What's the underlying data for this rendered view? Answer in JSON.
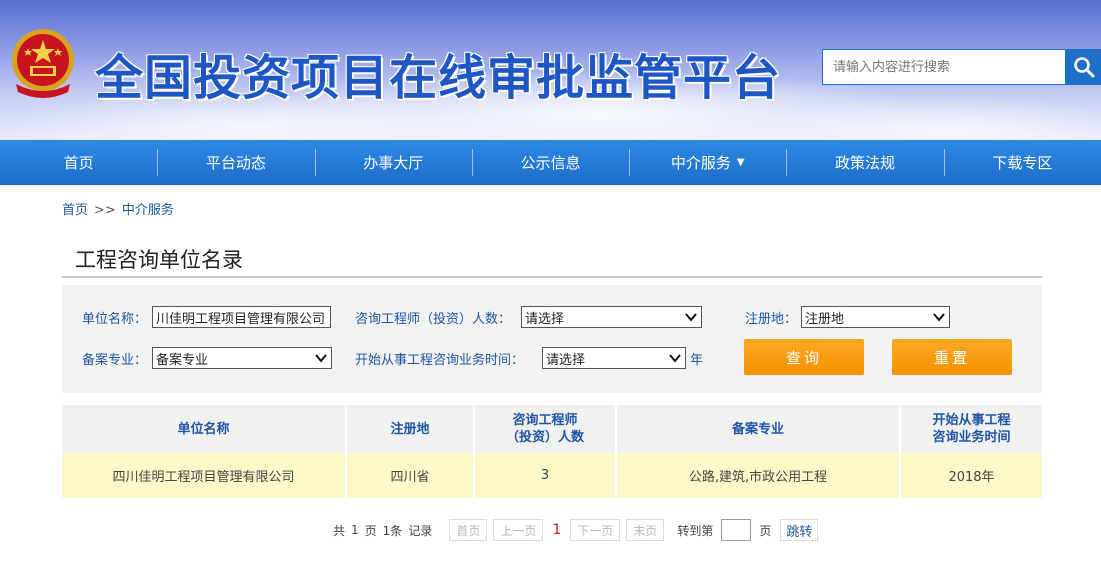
{
  "header": {
    "site_title": "全国投资项目在线审批监管平台",
    "search_placeholder": "请输入内容进行搜索"
  },
  "nav": {
    "items": [
      {
        "label": "首页"
      },
      {
        "label": "平台动态"
      },
      {
        "label": "办事大厅"
      },
      {
        "label": "公示信息"
      },
      {
        "label": "中介服务",
        "has_dropdown": true
      },
      {
        "label": "政策法规"
      },
      {
        "label": "下载专区"
      }
    ],
    "dropdown_caret": "▼"
  },
  "breadcrumb": {
    "home": "首页",
    "separator": ">>",
    "current": "中介服务"
  },
  "page_title": "工程咨询单位名录",
  "filters": {
    "unit_name_label": "单位名称：",
    "unit_name_value": "川佳明工程项目管理有限公司",
    "engineer_count_label": "咨询工程师（投资）人数：",
    "engineer_count_value": "请选择",
    "reg_place_label": "注册地：",
    "reg_place_value": "注册地",
    "specialty_label": "备案专业：",
    "specialty_value": "备案专业",
    "start_year_label": "开始从事工程咨询业务时间：",
    "start_year_value": "请选择",
    "year_suffix": "年",
    "query_button": "查询",
    "reset_button": "重置"
  },
  "table": {
    "headers": [
      "单位名称",
      "注册地",
      "咨询工程师（投资）人数",
      "备案专业",
      "开始从事工程咨询业务时间"
    ],
    "rows": [
      [
        "四川佳明工程项目管理有限公司",
        "四川省",
        "3",
        "公路,建筑,市政公用工程",
        "2018年"
      ]
    ]
  },
  "pager": {
    "total_prefix": "共",
    "total_pages": "1",
    "page_unit": "页",
    "total_records": "1条",
    "record_unit": "记录",
    "first": "首页",
    "prev": "上一页",
    "current": "1",
    "next": "下一页",
    "last": "末页",
    "goto_label": "转到第",
    "goto_suffix": "页",
    "jump_button": "跳转"
  },
  "colors": {
    "nav_blue": "#1d6cc8",
    "title_blue": "#1e56c6",
    "label_blue": "#1e56a6",
    "orange": "#f49200",
    "row_highlight": "#fcf8c8"
  }
}
